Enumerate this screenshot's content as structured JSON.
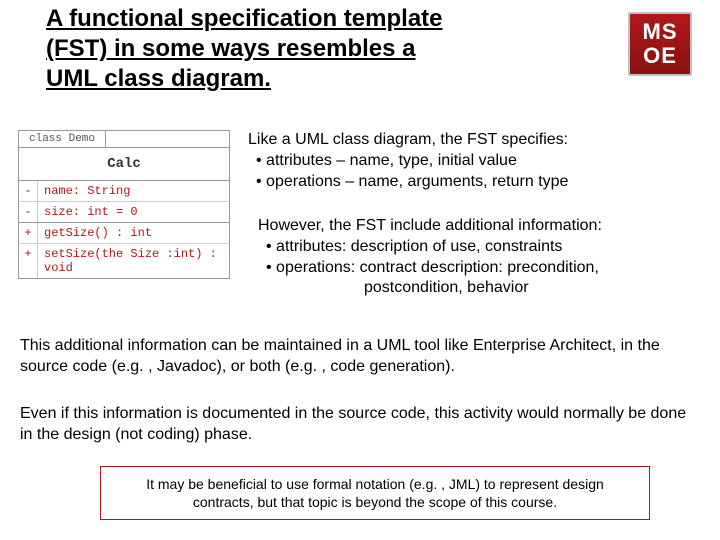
{
  "title": "A functional specification template (FST) in some ways resembles a UML class diagram.",
  "logo": {
    "line1": "MS",
    "line2": "OE"
  },
  "uml": {
    "tab": "class Demo",
    "name": "Calc",
    "attrs": [
      {
        "vis": "-",
        "sig": "name: String"
      },
      {
        "vis": "-",
        "sig": "size:  int = 0"
      }
    ],
    "ops": [
      {
        "vis": "+",
        "sig": "getSize() : int"
      },
      {
        "vis": "+",
        "sig": "setSize(the Size :int) : void"
      }
    ]
  },
  "sec1": {
    "intro": "Like a UML class diagram, the FST specifies:",
    "b1": "attributes – name, type, initial value",
    "b2": "operations – name, arguments, return type"
  },
  "sec2": {
    "intro": "However, the FST include additional information:",
    "b1": "attributes:  description of use, constraints",
    "b2": "operations: contract description: precondition,",
    "b2b": "postcondition, behavior"
  },
  "sec3": "This additional information can be maintained in a UML tool like Enterprise Architect, in the source code (e.g. , Javadoc), or both (e.g. , code generation).",
  "sec4": "Even if this information is documented in the source code, this activity would normally be done in the design (not coding) phase.",
  "callout": "It may be beneficial to use formal notation (e.g. , JML) to represent design contracts, but that topic is beyond the scope of this course."
}
